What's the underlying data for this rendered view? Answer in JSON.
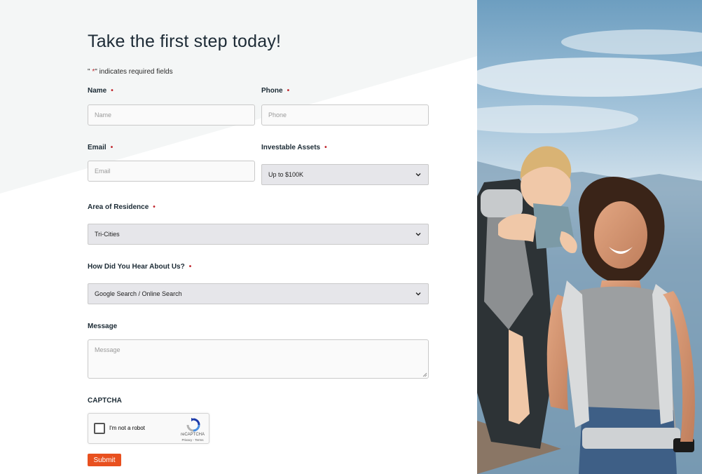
{
  "form": {
    "title": "Take the first step today!",
    "required_note_prefix": "\" ",
    "required_note_star": "*",
    "required_note_suffix": "\" indicates required fields",
    "required_star": "•",
    "fields": {
      "name": {
        "label": "Name",
        "placeholder": "Name",
        "value": ""
      },
      "phone": {
        "label": "Phone",
        "placeholder": "Phone",
        "value": ""
      },
      "email": {
        "label": "Email",
        "placeholder": "Email",
        "value": ""
      },
      "assets": {
        "label": "Investable Assets",
        "selected": "Up to $100K"
      },
      "residence": {
        "label": "Area of Residence",
        "selected": "Tri-Cities"
      },
      "heard": {
        "label": "How Did You Hear About Us?",
        "selected": "Google Search / Online Search"
      },
      "message": {
        "label": "Message",
        "placeholder": "Message",
        "value": ""
      }
    },
    "captcha": {
      "label": "CAPTCHA",
      "checkbox_text": "I'm not a robot",
      "brand": "reCAPTCHA",
      "links": "Privacy - Terms"
    },
    "submit_label": "Submit"
  },
  "colors": {
    "accent": "#e8501f",
    "required": "#c0262d",
    "text": "#1b2a34",
    "select_bg": "#e6e6ea",
    "background_shape": "#f4f6f6"
  },
  "image": {
    "icon": "photo-mother-and-baby-hiking"
  }
}
